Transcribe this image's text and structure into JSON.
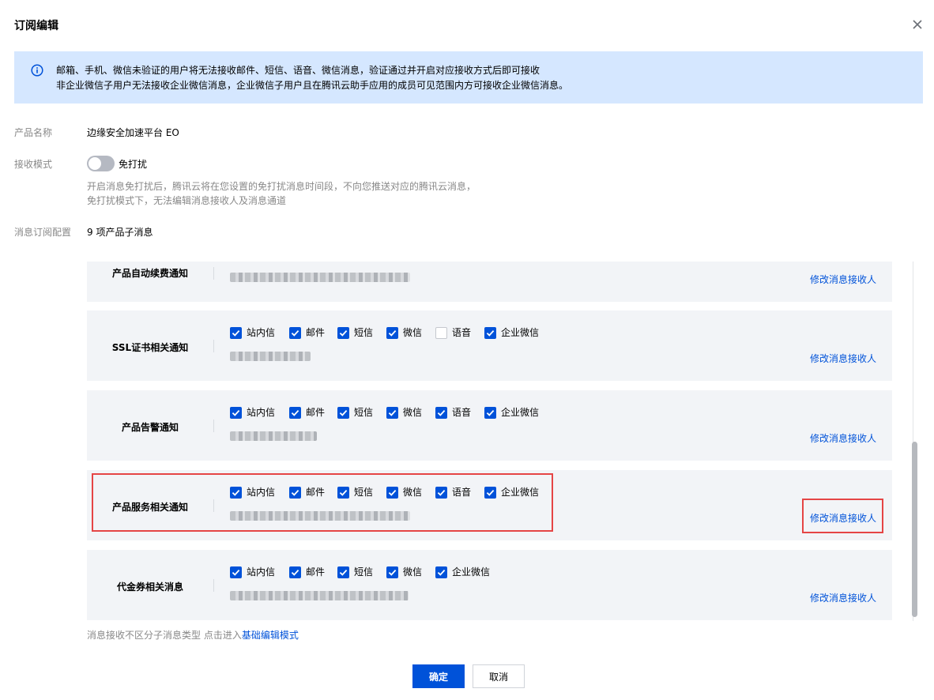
{
  "dialog": {
    "title": "订阅编辑",
    "close_icon": "close-icon"
  },
  "alert": {
    "icon": "info-circle-icon",
    "line1": "邮箱、手机、微信未验证的用户将无法接收邮件、短信、语音、微信消息，验证通过并开启对应接收方式后即可接收",
    "line2": "非企业微信子用户无法接收企业微信消息，企业微信子用户且在腾讯云助手应用的成员可见范围内方可接收企业微信消息。"
  },
  "form": {
    "product_label": "产品名称",
    "product_value": "边缘安全加速平台 EO",
    "mode_label": "接收模式",
    "dnd_toggle": {
      "label": "免打扰",
      "checked": false
    },
    "dnd_help_1": "开启消息免打扰后，腾讯云将在您设置的免打扰消息时间段，不向您推送对应的腾讯云消息，",
    "dnd_help_2": "免打扰模式下，无法编辑消息接收人及消息通道",
    "config_label": "消息订阅配置",
    "config_value": "9 项产品子消息"
  },
  "subscriptions": [
    {
      "name": "产品自动续费通知",
      "channels": [],
      "link": "修改消息接收人"
    },
    {
      "name": "SSL证书相关通知",
      "channels": [
        {
          "label": "站内信",
          "checked": true
        },
        {
          "label": "邮件",
          "checked": true
        },
        {
          "label": "短信",
          "checked": true
        },
        {
          "label": "微信",
          "checked": true
        },
        {
          "label": "语音",
          "checked": false
        },
        {
          "label": "企业微信",
          "checked": true
        }
      ],
      "link": "修改消息接收人"
    },
    {
      "name": "产品告警通知",
      "channels": [
        {
          "label": "站内信",
          "checked": true
        },
        {
          "label": "邮件",
          "checked": true
        },
        {
          "label": "短信",
          "checked": true
        },
        {
          "label": "微信",
          "checked": true
        },
        {
          "label": "语音",
          "checked": true
        },
        {
          "label": "企业微信",
          "checked": true
        }
      ],
      "link": "修改消息接收人"
    },
    {
      "name": "产品服务相关通知",
      "channels": [
        {
          "label": "站内信",
          "checked": true
        },
        {
          "label": "邮件",
          "checked": true
        },
        {
          "label": "短信",
          "checked": true
        },
        {
          "label": "微信",
          "checked": true
        },
        {
          "label": "语音",
          "checked": true
        },
        {
          "label": "企业微信",
          "checked": true
        }
      ],
      "link": "修改消息接收人",
      "highlighted": true
    },
    {
      "name": "代金券相关消息",
      "channels": [
        {
          "label": "站内信",
          "checked": true
        },
        {
          "label": "邮件",
          "checked": true
        },
        {
          "label": "短信",
          "checked": true
        },
        {
          "label": "微信",
          "checked": true
        },
        {
          "label": "企业微信",
          "checked": true
        }
      ],
      "link": "修改消息接收人"
    }
  ],
  "footer": {
    "hint": "消息接收不区分子消息类型 点击进入",
    "hint_link": "基础编辑模式"
  },
  "buttons": {
    "confirm": "确定",
    "cancel": "取消"
  },
  "colors": {
    "accent": "#0052d9",
    "alert_bg": "#d5e7ff",
    "card_bg": "#f2f4f7",
    "highlight": "#e54545"
  }
}
